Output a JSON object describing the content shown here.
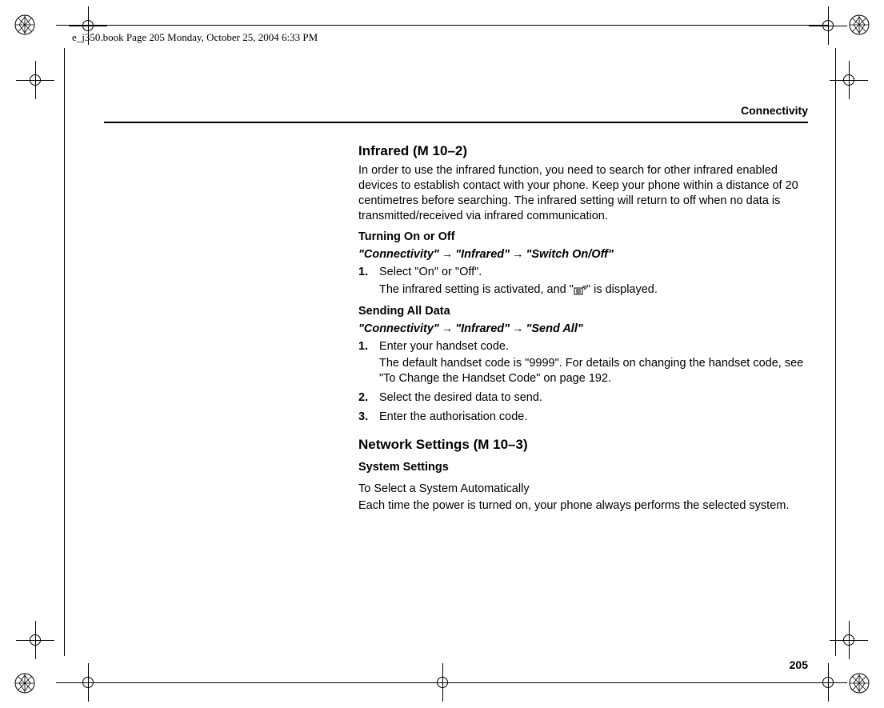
{
  "header_meta": "e_j350.book  Page 205  Monday, October 25, 2004  6:33 PM",
  "section_label": "Connectivity",
  "page_number": "205",
  "infrared": {
    "heading": "Infrared (M 10–2)",
    "intro": "In order to use the infrared function, you need to search for other infrared enabled devices to establish contact with your phone. Keep your phone within a distance of 20 centimetres before searching. The infrared setting will return to off when no data is transmitted/received via infrared communication.",
    "turning": {
      "sub": "Turning On or Off",
      "path1": "\"Connectivity\"",
      "path2": "\"Infrared\"",
      "path3": "\"Switch On/Off\"",
      "step1_num": "1.",
      "step1": "Select \"On\" or \"Off\".",
      "step1_note_a": "The infrared setting is activated, and \"",
      "step1_note_b": "\" is displayed."
    },
    "sending": {
      "sub": "Sending All Data",
      "path1": "\"Connectivity\"",
      "path2": "\"Infrared\"",
      "path3": "\"Send All\"",
      "step1_num": "1.",
      "step1": "Enter your handset code.",
      "step1_note": "The default handset code is \"9999\". For details on changing the handset code, see \"To Change the Handset Code\" on page 192.",
      "step2_num": "2.",
      "step2": "Select the desired data to send.",
      "step3_num": "3.",
      "step3": "Enter the authorisation code."
    }
  },
  "network": {
    "heading": "Network Settings (M 10–3)",
    "sub": "System Settings",
    "auto_title": "To Select a System Automatically",
    "auto_text": "Each time the power is turned on, your phone always performs the selected system."
  }
}
